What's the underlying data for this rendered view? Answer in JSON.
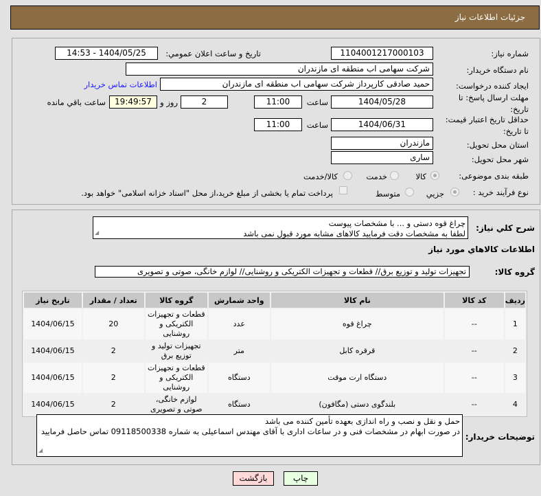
{
  "header": {
    "title": "جزئیات اطلاعات نیاز"
  },
  "form": {
    "need_number_label": "شماره نیاز:",
    "need_number": "1104001217000103",
    "announce_label": "تاریخ و ساعت اعلان عمومي:",
    "announce_value": "1404/05/25 - 14:53",
    "buyer_org_label": "نام دستگاه خریدار:",
    "buyer_org": "شرکت سهامی اب منطقه ای مازندران",
    "creator_label": "ایجاد کننده درخواست:",
    "creator": "حمید  صادقی کارپرداز شرکت سهامی اب منطقه ای مازندران",
    "contact_link": "اطلاعات تماس خریدار",
    "deadline_label_1": "مهلت ارسال پاسخ: تا",
    "deadline_label_2": "تاریخ:",
    "deadline_date": "1404/05/28",
    "time_label": "ساعت",
    "deadline_time": "11:00",
    "days": "2",
    "days_label": "روز و",
    "remaining": "19:49:57",
    "remaining_label": "ساعت باقي مانده",
    "validity_label_1": "حداقل تاریخ اعتبار قیمت:",
    "validity_label_2": "تا تاریخ:",
    "validity_date": "1404/06/31",
    "validity_time": "11:00",
    "province_label": "استان محل تحویل:",
    "province": "مازندران",
    "city_label": "شهر محل تحویل:",
    "city": "ساری",
    "category_label": "طبقه بندی موضوعی:",
    "category_options": [
      "کالا",
      "خدمت",
      "کالا/خدمت"
    ],
    "process_label": "نوع فرآیند خرید :",
    "process_options": [
      "جزیي",
      "متوسط"
    ],
    "payment_note": "پرداخت تمام یا بخشی از مبلغ خرید،از محل \"اسناد خزانه اسلامی\" خواهد بود."
  },
  "details": {
    "summary_label": "شرح کلي نياز:",
    "summary_line1": "چراغ قوه دستی  و ... با مشخصات پیوست",
    "summary_line2": "لطفا به مشخصات دقت فرمایید کالاهای مشابه مورد قبول نمی باشد",
    "goods_title": "اطلاعات كالاهاي مورد نياز",
    "group_label": "گروه کالا:",
    "group_value": "تجهیزات تولید و توزیع برق// قطعات و تجهیزات الکتریکی و روشنایی// لوازم خانگی، صوتی و تصویری",
    "table": {
      "headers": [
        "ردیف",
        "کد کالا",
        "نام کالا",
        "واحد شمارش",
        "گروه کالا",
        "تعداد / مقدار",
        "تاریخ نیاز"
      ],
      "rows": [
        [
          "1",
          "--",
          "چراغ قوه",
          "عدد",
          "قطعات و تجهیزات الکتریکی و روشنایی",
          "20",
          "1404/06/15"
        ],
        [
          "2",
          "--",
          "قرقره کابل",
          "متر",
          "تجهیزات تولید و توزیع برق",
          "2",
          "1404/06/15"
        ],
        [
          "3",
          "--",
          "دستگاه ارت موقت",
          "دستگاه",
          "قطعات و تجهیزات الکتریکی و روشنایی",
          "2",
          "1404/06/15"
        ],
        [
          "4",
          "--",
          "بلندگوی دستی (مگافون)",
          "دستگاه",
          "لوازم خانگی، صوتی و تصویری",
          "2",
          "1404/06/15"
        ]
      ]
    },
    "buyer_notes_label": "توضیحات خریدار:",
    "buyer_notes_line1": "حمل و نقل و نصب و راه اندازی بعهده تأمین کننده می باشد",
    "buyer_notes_line2": "در صورت ابهام در مشخصات فنی و در ساعات اداری با آقای مهندس اسماعیلی به شماره 09118500338 تماس حاصل فرمایید"
  },
  "buttons": {
    "print": "چاپ",
    "back": "بازگشت"
  }
}
